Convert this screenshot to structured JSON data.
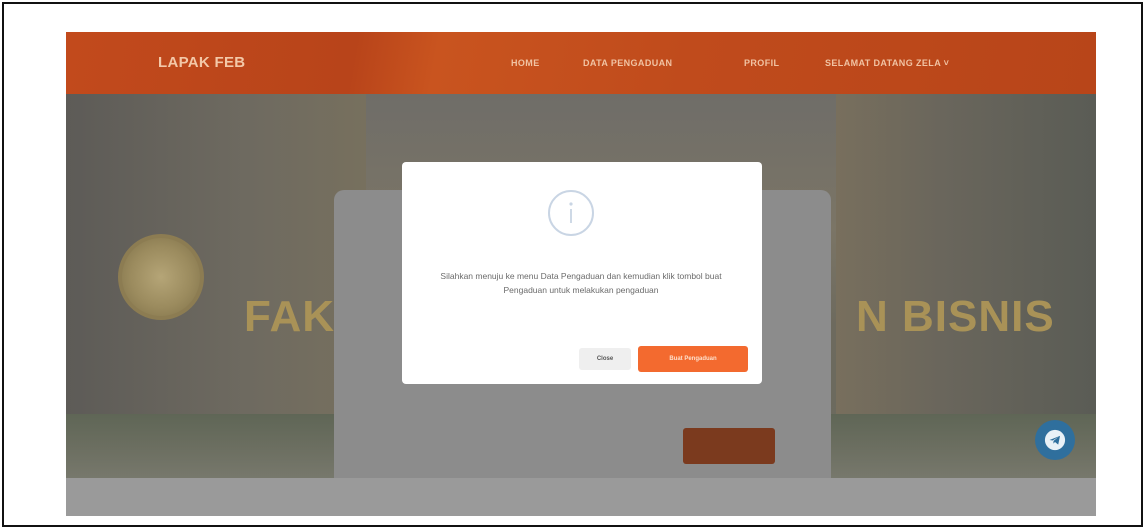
{
  "navbar": {
    "brand": "LAPAK FEB",
    "links": [
      {
        "label": "HOME"
      },
      {
        "label": "DATA PENGADUAN"
      },
      {
        "label": "PROFIL"
      },
      {
        "label": "SELAMAT DATANG ZELA ˅"
      }
    ]
  },
  "hero": {
    "sign_left": "FAK",
    "sign_right": "N BISNIS"
  },
  "alert": {
    "icon": "info-icon",
    "message": "Silahkan menuju ke menu Data Pengaduan dan kemudian klik tombol buat Pengaduan untuk melakukan pengaduan",
    "close_label": "Close",
    "primary_label": "Buat Pengaduan"
  },
  "fab": {
    "icon": "telegram-icon"
  },
  "colors": {
    "navbar": "#c04b1c",
    "primary_button": "#f36a2f",
    "fab": "#2f6f9d"
  }
}
